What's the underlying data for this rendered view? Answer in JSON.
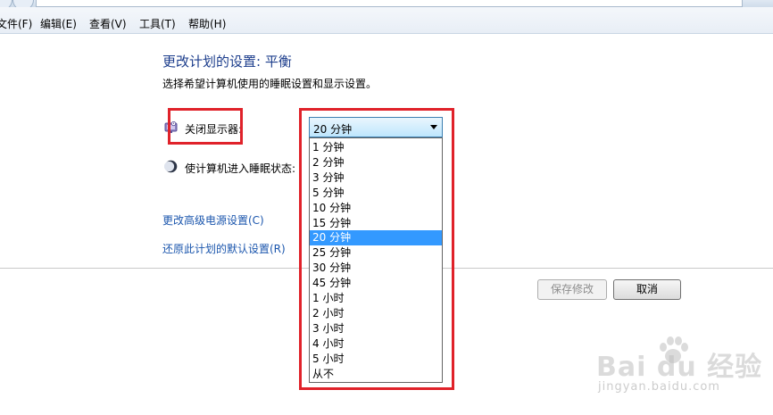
{
  "menubar": {
    "items": [
      "文件(F)",
      "编辑(E)",
      "查看(V)",
      "工具(T)",
      "帮助(H)"
    ]
  },
  "page": {
    "title": "更改计划的设置: 平衡",
    "subtitle": "选择希望计算机使用的睡眠设置和显示设置。"
  },
  "settings": {
    "display_label": "关闭显示器:",
    "sleep_label": "使计算机进入睡眠状态:",
    "display_icon": "monitor-icon",
    "sleep_icon": "moon-sleep-icon"
  },
  "dropdown": {
    "selected": "20 分钟",
    "options": [
      "1 分钟",
      "2 分钟",
      "3 分钟",
      "5 分钟",
      "10 分钟",
      "15 分钟",
      "20 分钟",
      "25 分钟",
      "30 分钟",
      "45 分钟",
      "1 小时",
      "2 小时",
      "3 小时",
      "4 小时",
      "5 小时",
      "从不"
    ]
  },
  "links": {
    "advanced": "更改高级电源设置(C)",
    "restore": "还原此计划的默认设置(R)"
  },
  "buttons": {
    "save": "保存修改",
    "cancel": "取消"
  },
  "watermark": {
    "logo_text": "Bai  du 经验",
    "url": "jingyan.baidu.com"
  },
  "colors": {
    "highlight": "#e0222a",
    "selection": "#3399ff",
    "title": "#1c3d8c",
    "link": "#1b56ad"
  }
}
